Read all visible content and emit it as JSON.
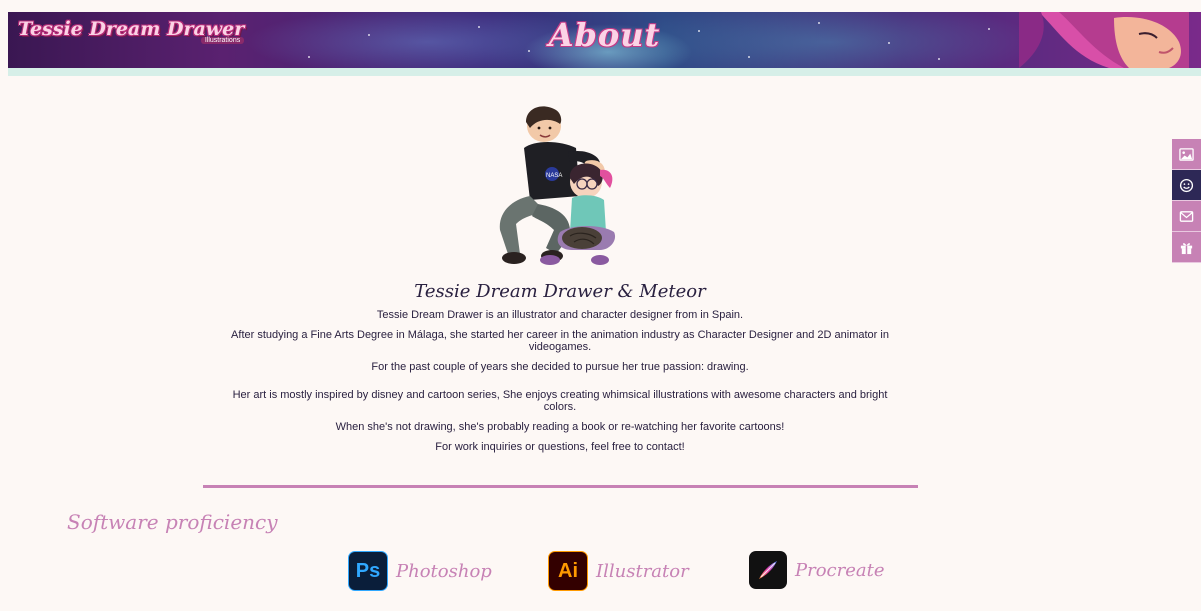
{
  "header": {
    "logo_text": "Tessie Dream Drawer",
    "logo_subtitle": "Illustrations",
    "page_title": "About"
  },
  "sidenav": {
    "items": [
      {
        "name": "gallery",
        "icon": "image-icon",
        "active": false
      },
      {
        "name": "about",
        "icon": "smiley-icon",
        "active": true
      },
      {
        "name": "contact",
        "icon": "mail-icon",
        "active": false
      },
      {
        "name": "shop",
        "icon": "gift-icon",
        "active": false
      }
    ]
  },
  "about": {
    "name": "Tessie Dream Drawer & Meteor",
    "paragraphs": [
      "Tessie Dream Drawer is an illustrator and character designer from in Spain.",
      "After studying a Fine Arts Degree in Málaga, she started her career in the animation industry as Character Designer and 2D animator in videogames.",
      "For the past couple of years she decided to pursue her true passion: drawing.",
      "Her art is mostly inspired by disney and cartoon series, She enjoys creating whimsical illustrations with awesome characters and bright colors.",
      "When she's not drawing, she's probably reading a book or re-watching her favorite cartoons!",
      "For work inquiries or questions, feel free to contact!"
    ]
  },
  "software": {
    "title": "Software proficiency",
    "items": [
      {
        "abbr": "Ps",
        "label": "Photoshop"
      },
      {
        "abbr": "Ai",
        "label": "Illustrator"
      },
      {
        "abbr": "",
        "label": "Procreate"
      }
    ]
  },
  "colors": {
    "accent": "#c782b5",
    "nav_active": "#2d2856",
    "background": "#fdf8f5",
    "text": "#2a2140"
  }
}
